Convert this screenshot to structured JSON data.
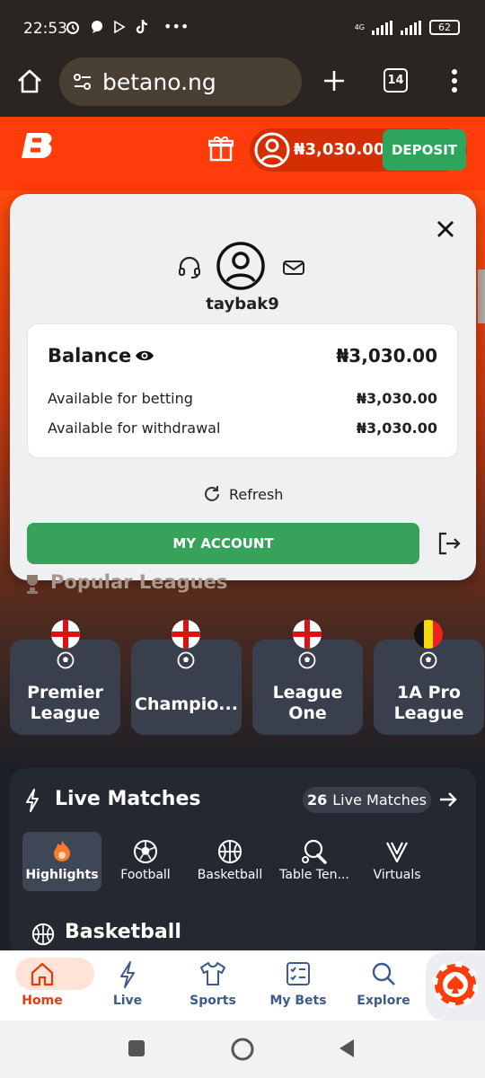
{
  "status_bar": {
    "time": "22:53",
    "dots": "•••",
    "network": "4G",
    "battery": "62"
  },
  "browser": {
    "url": "betano.ng",
    "tab_count": "14"
  },
  "header": {
    "balance": "₦3,030.00",
    "deposit_label": "DEPOSIT"
  },
  "account_modal": {
    "username": "taybak9",
    "balance_label": "Balance",
    "balance_value": "₦3,030.00",
    "rows": [
      {
        "label": "Available for betting",
        "value": "₦3,030.00"
      },
      {
        "label": "Available for withdrawal",
        "value": "₦3,030.00"
      }
    ],
    "refresh_label": "Refresh",
    "my_account_label": "MY ACCOUNT"
  },
  "popular_leagues": {
    "title": "Popular Leagues",
    "items": [
      {
        "name": "Premier League"
      },
      {
        "name": "Champio..."
      },
      {
        "name": "League One"
      },
      {
        "name": "1A Pro League"
      }
    ]
  },
  "live_matches": {
    "title": "Live Matches",
    "count": "26",
    "count_label": "Live Matches",
    "categories": [
      {
        "label": "Highlights"
      },
      {
        "label": "Football"
      },
      {
        "label": "Basketball"
      },
      {
        "label": "Table Ten..."
      },
      {
        "label": "Virtuals"
      }
    ],
    "section_title": "Basketball"
  },
  "bottom_nav": {
    "items": [
      {
        "label": "Home"
      },
      {
        "label": "Live"
      },
      {
        "label": "Sports"
      },
      {
        "label": "My Bets"
      },
      {
        "label": "Explore"
      }
    ]
  },
  "colors": {
    "brand": "#ff3c0a",
    "green": "#36a25a",
    "dark": "#242830"
  }
}
